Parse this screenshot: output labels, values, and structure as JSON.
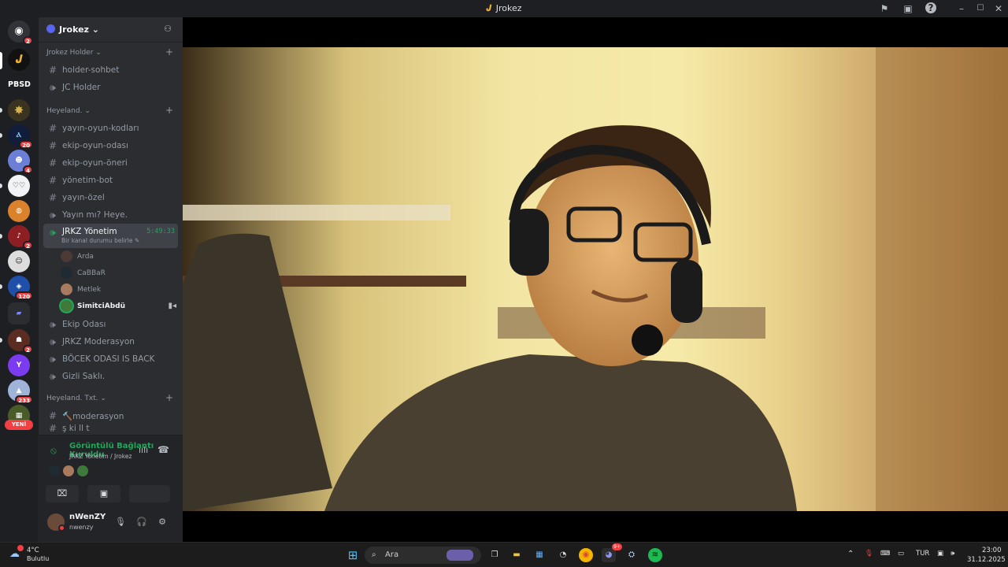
{
  "titlebar": {
    "title": "Jrokez"
  },
  "serverbar": {
    "badges": [
      "2",
      "20",
      "4",
      "2",
      "120",
      "2",
      "233"
    ],
    "new_label": "YENİ",
    "pbsd_label": "PBSD"
  },
  "guild": {
    "name": "Jrokez"
  },
  "categories": {
    "jrokez_holder": "Jrokez Holder",
    "heyeland": "Heyeland.",
    "heyeland_txt": "Heyeland. Txt."
  },
  "channels": {
    "holder_sohbet": "holder-sohbet",
    "jc_holder": "JC Holder",
    "yayin_oyun_kodlari": "yayın-oyun-kodları",
    "ekip_oyun_odasi": "ekip-oyun-odası",
    "ekip_oyun_oneri": "ekip-oyun-öneri",
    "yonetim_bot": "yönetim-bot",
    "yayin_ozel": "yayın-özel",
    "yayin_mi": "Yayın mı? Heye.",
    "jrkz_yonetim": "JRKZ Yönetim",
    "jrkz_yonetim_timer": "5:49:33",
    "jrkz_yonetim_status": "Bir kanal durumu belirle",
    "ekip_odasi": "Ekip Odası",
    "jrkz_moderasyon": "JRKZ Moderasyon",
    "bocek": "BÖCEK ODASI IS BACK",
    "gizli": "Gizli Saklı.",
    "moderasyon": "🔨moderasyon",
    "partial": "ş ki ll  t"
  },
  "voice_users": [
    "Arda",
    "CaBBaR",
    "Metlek",
    "SimitciAbdü"
  ],
  "voice_panel": {
    "status": "Görüntülü Bağlantı Kuruldu",
    "location": "JRKZ Yönetim / Jrokez"
  },
  "user": {
    "name": "nWenZY",
    "tag": "nwenzy"
  },
  "taskbar": {
    "weather_temp": "4°C",
    "weather_desc": "Bulutlu",
    "search_placeholder": "Ara",
    "lang": "TUR",
    "time": "23:00",
    "date": "31.12.2025",
    "discord_badge": "9+"
  },
  "colors": {
    "green": "#23a55a",
    "red": "#f23f43",
    "blurple": "#5865f2"
  }
}
